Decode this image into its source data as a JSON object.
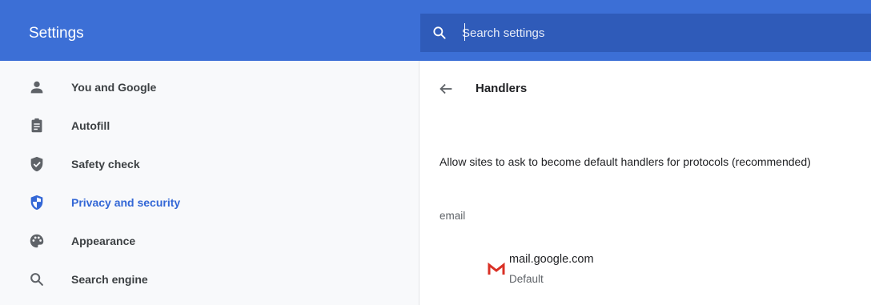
{
  "header": {
    "title": "Settings"
  },
  "search": {
    "placeholder": "Search settings",
    "value": ""
  },
  "sidebar": {
    "items": [
      {
        "label": "You and Google",
        "icon": "person-icon",
        "active": false
      },
      {
        "label": "Autofill",
        "icon": "clipboard-icon",
        "active": false
      },
      {
        "label": "Safety check",
        "icon": "shield-check-icon",
        "active": false
      },
      {
        "label": "Privacy and security",
        "icon": "shield-half-icon",
        "active": true
      },
      {
        "label": "Appearance",
        "icon": "palette-icon",
        "active": false
      },
      {
        "label": "Search engine",
        "icon": "search-icon",
        "active": false
      }
    ]
  },
  "main": {
    "title": "Handlers",
    "toggle_text": "Allow sites to ask to become default handlers for protocols (recommended)",
    "section_label": "email",
    "handlers": [
      {
        "site": "mail.google.com",
        "subtitle": "Default",
        "icon": "gmail-icon"
      }
    ]
  },
  "colors": {
    "header": "#3c6fd6",
    "search_box": "#2f5bb9",
    "sidebar": "#f8f9fb",
    "active": "#3367d6",
    "icon": "#5f6368"
  }
}
